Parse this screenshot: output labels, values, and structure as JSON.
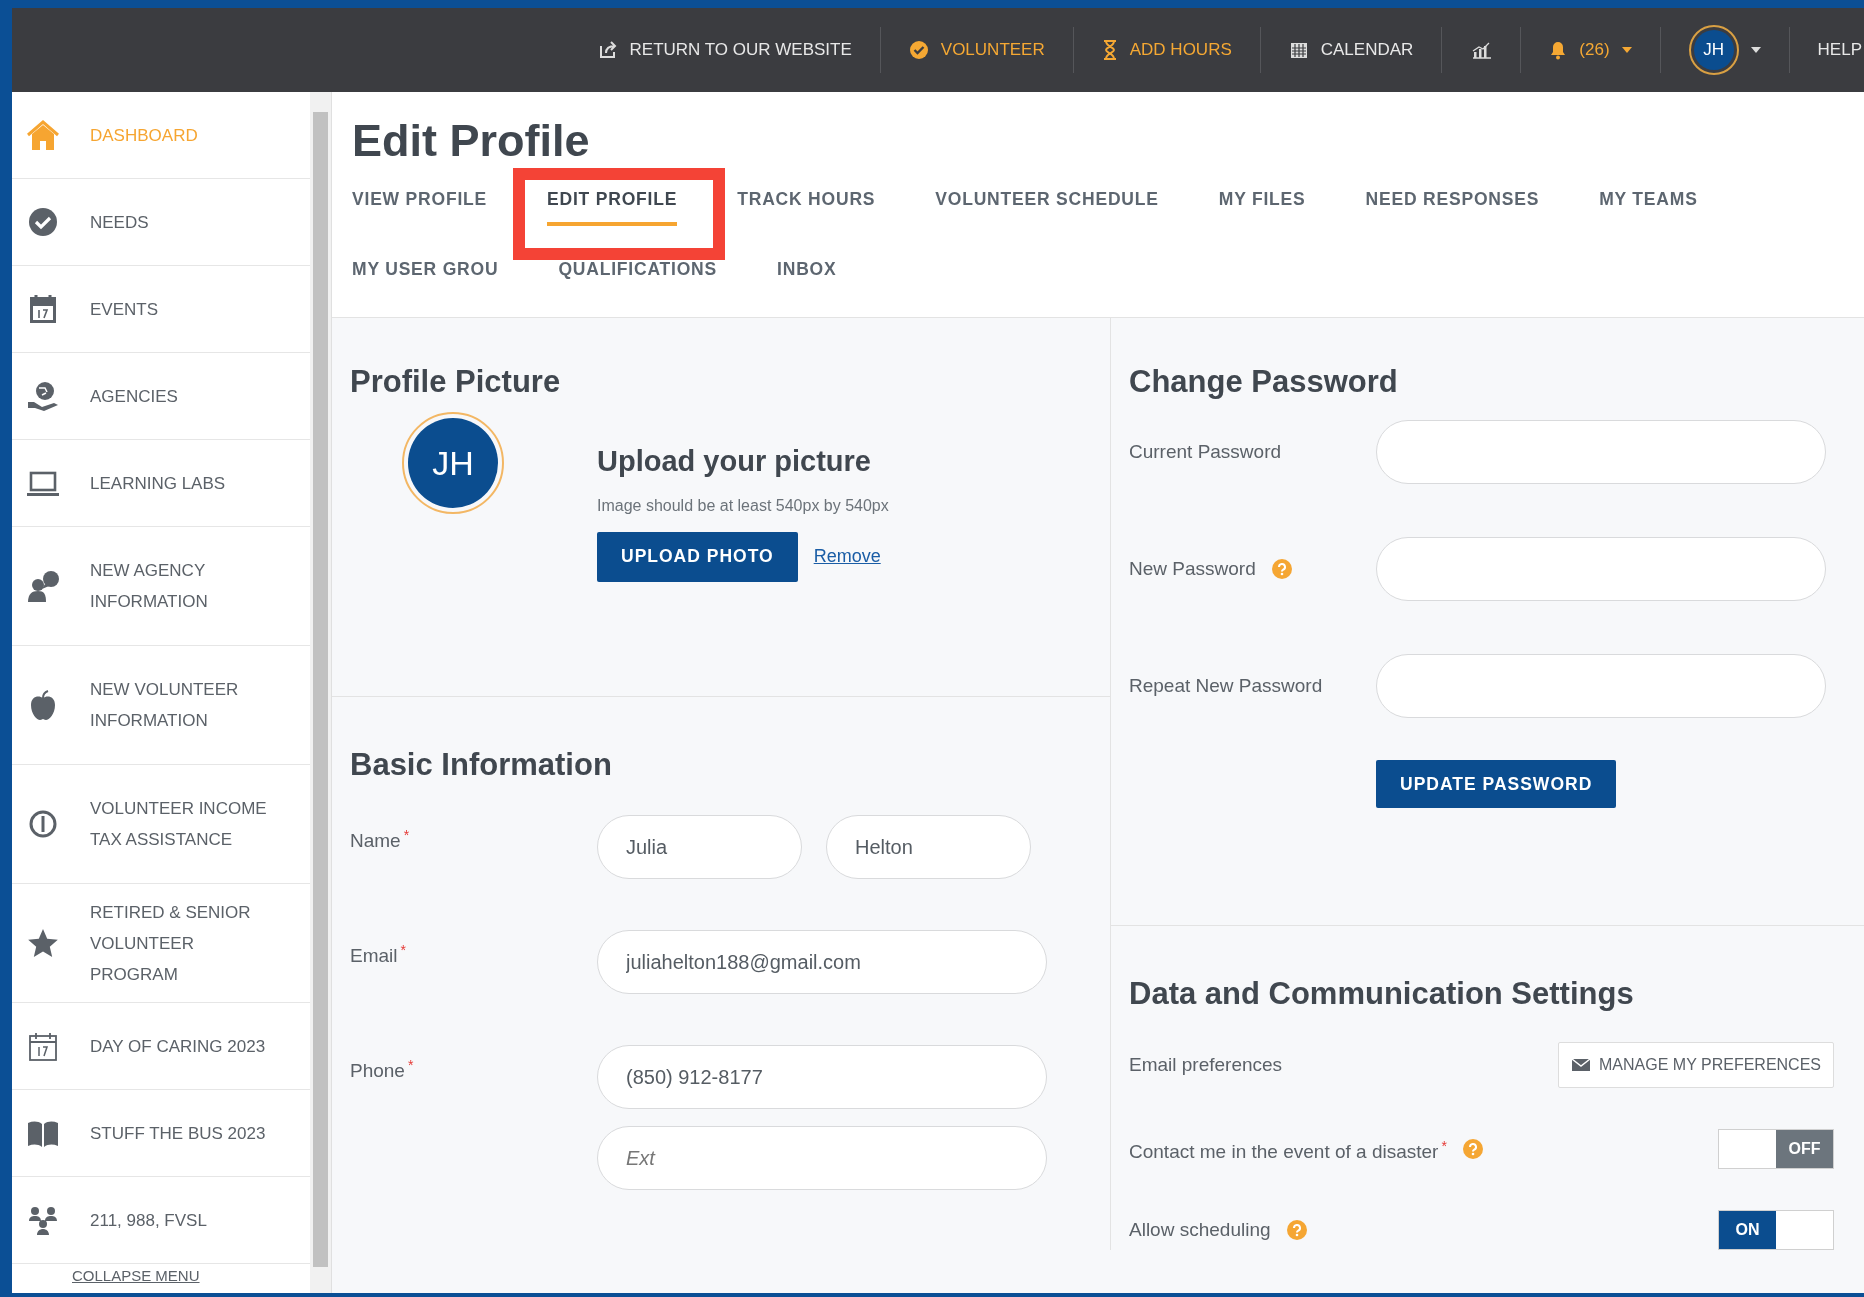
{
  "top_nav": {
    "items": [
      {
        "kind": "link",
        "label": "RETURN TO OUR WEBSITE",
        "highlighted": false
      },
      {
        "kind": "link",
        "label": "VOLUNTEER",
        "highlighted": true
      },
      {
        "kind": "link",
        "label": "ADD HOURS",
        "highlighted": true
      },
      {
        "kind": "link",
        "label": "CALENDAR",
        "highlighted": false
      },
      {
        "kind": "icon"
      },
      {
        "kind": "notifications",
        "label": "(26)",
        "highlighted": true
      },
      {
        "kind": "avatar",
        "label": "JH"
      },
      {
        "kind": "link",
        "label": "HELP",
        "highlighted": false
      }
    ]
  },
  "sidebar": {
    "items": [
      {
        "label": "DASHBOARD",
        "selected": true
      },
      {
        "label": "NEEDS",
        "selected": false
      },
      {
        "label": "EVENTS",
        "selected": false
      },
      {
        "label": "AGENCIES",
        "selected": false
      },
      {
        "label": "LEARNING LABS",
        "selected": false
      },
      {
        "label": "NEW AGENCY INFORMATION",
        "selected": false
      },
      {
        "label": "NEW VOLUNTEER INFORMATION",
        "selected": false
      },
      {
        "label": "VOLUNTEER INCOME TAX ASSISTANCE",
        "selected": false
      },
      {
        "label": "RETIRED & SENIOR VOLUNTEER PROGRAM",
        "selected": false
      },
      {
        "label": "DAY OF CARING 2023",
        "selected": false
      },
      {
        "label": "STUFF THE BUS 2023",
        "selected": false
      },
      {
        "label": "211, 988, FVSL",
        "selected": false
      }
    ],
    "collapse": "COLLAPSE MENU"
  },
  "page": {
    "title": "Edit Profile",
    "tab_rows": [
      [
        {
          "label": "VIEW PROFILE",
          "selected": false
        },
        {
          "label": "EDIT PROFILE",
          "selected": true
        },
        {
          "label": "TRACK HOURS",
          "selected": false
        },
        {
          "label": "VOLUNTEER SCHEDULE",
          "selected": false
        },
        {
          "label": "MY FILES",
          "selected": false
        },
        {
          "label": "NEED RESPONSES",
          "selected": false
        },
        {
          "label": "MY TEAMS",
          "selected": false
        }
      ],
      [
        {
          "label": "MY USER GROU",
          "selected": false
        },
        {
          "label": "QUALIFICATIONS",
          "selected": false
        },
        {
          "label": "INBOX",
          "selected": false
        }
      ]
    ]
  },
  "profile_picture": {
    "heading": "Profile Picture",
    "avatar": "JH",
    "upload_heading": "Upload your picture",
    "hint": "Image should be at least 540px by 540px",
    "upload_button": "UPLOAD PHOTO",
    "remove_link": "Remove"
  },
  "basic_information": {
    "heading": "Basic Information",
    "fields": [
      {
        "label": "Name",
        "required": "*",
        "kind": "split",
        "inputs": [
          {
            "value": "Julia"
          },
          {
            "value": "Helton"
          }
        ]
      },
      {
        "label": "Email",
        "required": "*",
        "kind": "stacked",
        "inputs": [
          {
            "value": "juliahelton188@gmail.com"
          }
        ]
      },
      {
        "label": "Phone",
        "required": "*",
        "kind": "stacked",
        "inputs": [
          {
            "value": "(850) 912-8177"
          },
          {
            "placeholder": "Ext"
          }
        ]
      }
    ]
  },
  "change_password": {
    "heading": "Change Password",
    "fields": [
      {
        "label": "Current Password",
        "help": false
      },
      {
        "label": "New Password",
        "help": true
      },
      {
        "label": "Repeat New Password",
        "help": false
      }
    ],
    "button": "UPDATE PASSWORD"
  },
  "data_settings": {
    "heading": "Data and Communication Settings",
    "rows": [
      {
        "kind": "button",
        "label": "Email preferences",
        "button": "MANAGE MY PREFERENCES"
      },
      {
        "kind": "toggle",
        "label": "Contact me in the event of a disaster",
        "required": "*",
        "help": true,
        "on": false,
        "toggle_text": "OFF"
      },
      {
        "kind": "toggle",
        "label": "Allow scheduling",
        "help": true,
        "on": true,
        "toggle_text": "ON"
      }
    ]
  }
}
